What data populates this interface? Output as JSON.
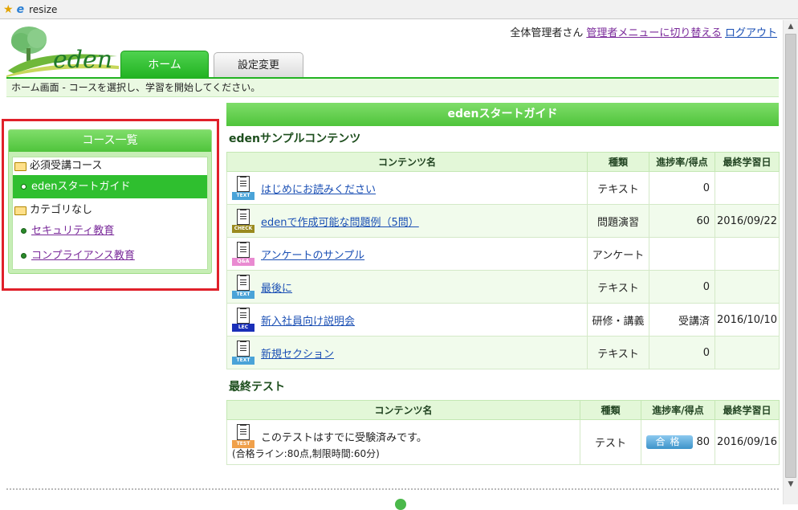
{
  "browser": {
    "tab_title": "resize"
  },
  "header": {
    "logo_text": "eden",
    "user_name": "全体管理者さん",
    "switch_admin_label": "管理者メニューに切り替える",
    "logout_label": "ログアウト",
    "tabs": [
      {
        "label": "ホーム",
        "active": true
      },
      {
        "label": "設定変更",
        "active": false
      }
    ],
    "info_message": "ホーム画面 - コースを選択し、学習を開始してください。"
  },
  "sidebar": {
    "title": "コース一覧",
    "categories": [
      {
        "label": "必須受講コース",
        "items": [
          {
            "label": "edenスタートガイド",
            "active": true
          }
        ]
      },
      {
        "label": "カテゴリなし",
        "items": [
          {
            "label": "セキュリティ教育"
          },
          {
            "label": "コンプライアンス教育"
          }
        ]
      }
    ]
  },
  "main": {
    "course_title": "edenスタートガイド",
    "sections": [
      {
        "title": "edenサンプルコンテンツ",
        "headers": [
          "コンテンツ名",
          "種類",
          "進捗率/得点",
          "最終学習日"
        ],
        "rows": [
          {
            "name": "はじめにお読みください",
            "type": "テキスト",
            "score": "0",
            "date": "",
            "icon": "text-icon",
            "icon_tag": "TEXT",
            "tag_color": "#4aa3d8"
          },
          {
            "name": "edenで作成可能な問題例（5問）",
            "type": "問題演習",
            "score": "60",
            "date": "2016/09/22",
            "icon": "check-icon",
            "icon_tag": "CHECK",
            "tag_color": "#9a8a1e"
          },
          {
            "name": "アンケートのサンプル",
            "type": "アンケート",
            "score": "",
            "date": "",
            "icon": "qa-icon",
            "icon_tag": "Q&A",
            "tag_color": "#e98ad1"
          },
          {
            "name": "最後に",
            "type": "テキスト",
            "score": "0",
            "date": "",
            "icon": "text-icon",
            "icon_tag": "TEXT",
            "tag_color": "#4aa3d8"
          },
          {
            "name": "新入社員向け説明会",
            "type": "研修・講義",
            "score": "受講済",
            "date": "2016/10/10",
            "icon": "lecture-icon",
            "icon_tag": "LEC",
            "tag_color": "#1a2fb8"
          },
          {
            "name": "新規セクション",
            "type": "テキスト",
            "score": "0",
            "date": "",
            "icon": "text-icon",
            "icon_tag": "TEXT",
            "tag_color": "#4aa3d8"
          }
        ]
      },
      {
        "title": "最終テスト",
        "headers": [
          "コンテンツ名",
          "種類",
          "進捗率/得点",
          "最終学習日"
        ],
        "rows": [
          {
            "name": "このテストはすでに受験済みです。",
            "subtext": "(合格ライン:80点,制限時間:60分)",
            "type": "テスト",
            "badge": "合格",
            "score": "80",
            "date": "2016/09/16",
            "icon": "test-icon",
            "icon_tag": "TEST",
            "tag_color": "#f0a04a"
          }
        ]
      }
    ]
  }
}
